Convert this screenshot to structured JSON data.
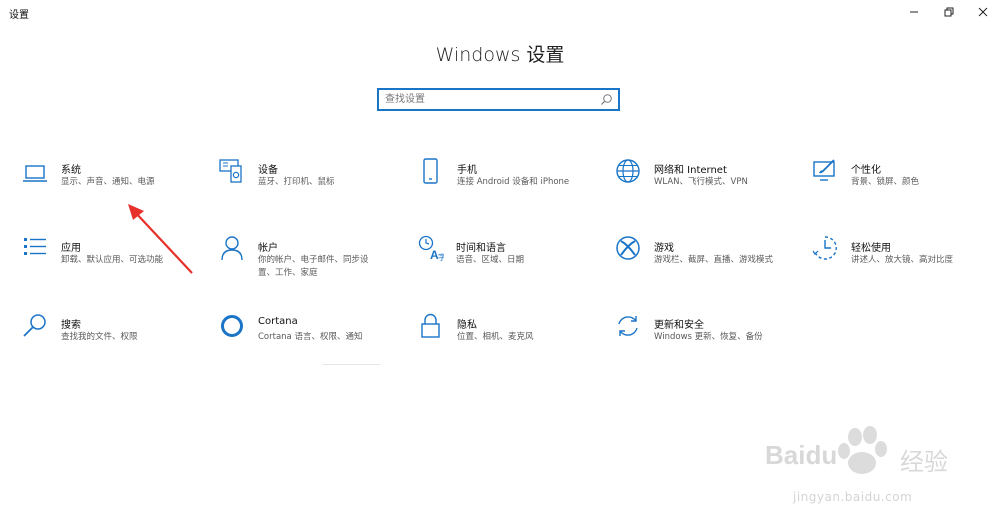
{
  "app": {
    "title": "设置"
  },
  "page": {
    "title": "Windows 设置"
  },
  "search": {
    "placeholder": "查找设置",
    "value": ""
  },
  "tiles": [
    {
      "name": "系统",
      "desc": "显示、声音、通知、电源",
      "icon": "laptop-icon"
    },
    {
      "name": "设备",
      "desc": "蓝牙、打印机、鼠标",
      "icon": "keyboard-icon"
    },
    {
      "name": "手机",
      "desc": "连接 Android 设备和 iPhone",
      "icon": "phone-icon"
    },
    {
      "name": "网络和 Internet",
      "desc": "WLAN、飞行模式、VPN",
      "icon": "globe-icon"
    },
    {
      "name": "个性化",
      "desc": "背景、锁屏、颜色",
      "icon": "paint-icon"
    },
    {
      "name": "应用",
      "desc": "卸载、默认应用、可选功能",
      "icon": "apps-list-icon"
    },
    {
      "name": "帐户",
      "desc": "你的帐户、电子邮件、同步设\n置、工作、家庭",
      "icon": "person-icon"
    },
    {
      "name": "时间和语言",
      "desc": "语音、区域、日期",
      "icon": "time-language-icon"
    },
    {
      "name": "游戏",
      "desc": "游戏栏、截屏、直播、游戏模式",
      "icon": "xbox-icon"
    },
    {
      "name": "轻松使用",
      "desc": "讲述人、放大镜、高对比度",
      "icon": "ease-of-access-icon"
    },
    {
      "name": "搜索",
      "desc": "查找我的文件、权限",
      "icon": "search-icon"
    },
    {
      "name": "Cortana",
      "desc": "Cortana 语言、权限、通知",
      "icon": "cortana-icon"
    },
    {
      "name": "隐私",
      "desc": "位置、相机、麦克风",
      "icon": "lock-icon"
    },
    {
      "name": "更新和安全",
      "desc": "Windows 更新、恢复、备份",
      "icon": "sync-icon"
    }
  ],
  "annotation": {
    "color": "#e8302a"
  },
  "watermark": {
    "text": "jingyan.baidu.com",
    "brand": "Baidu",
    "cn": "经验"
  },
  "colors": {
    "accent": "#1a74c7"
  }
}
